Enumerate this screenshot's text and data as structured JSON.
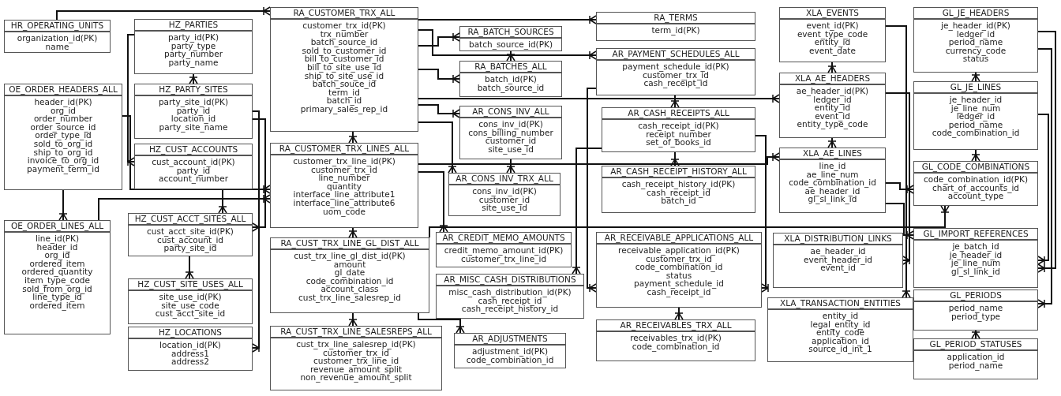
{
  "entities": [
    {
      "name": "HR_OPERATING_UNITS",
      "fields": [
        "organization_id(PK)",
        "name"
      ]
    },
    {
      "name": "HZ_PARTIES",
      "fields": [
        "party_id(PK)",
        "party_type",
        "party_number",
        "party_name"
      ]
    },
    {
      "name": "OE_ORDER_HEADERS_ALL",
      "fields": [
        "header_id(PK)",
        "org_id",
        "order_number",
        "order_source_id",
        "order_type_id",
        "sold_to_org_id",
        "ship_to_org_id",
        "invoice_to_org_id",
        "payment_term_id"
      ]
    },
    {
      "name": "HZ_PARTY_SITES",
      "fields": [
        "party_site_id(PK)",
        "party_id",
        "location_id",
        "party_site_name"
      ]
    },
    {
      "name": "HZ_CUST_ACCOUNTS",
      "fields": [
        "cust_account_id(PK)",
        "party_id",
        "account_number"
      ]
    },
    {
      "name": "OE_ORDER_LINES_ALL",
      "fields": [
        "line_id(PK)",
        "header_id",
        "org_id",
        "ordered_item",
        "ordered_quantity",
        "item_type_code",
        "sold_from_org_id",
        "line_type_id",
        "ordered_item"
      ]
    },
    {
      "name": "HZ_CUST_ACCT_SITES_ALL",
      "fields": [
        "cust_acct_site_id(PK)",
        "cust_account_id",
        "party_site_id"
      ]
    },
    {
      "name": "HZ_CUST_SITE_USES_ALL",
      "fields": [
        "site_use_id(PK)",
        "site_use_code",
        "cust_acct_site_id"
      ]
    },
    {
      "name": "HZ_LOCATIONS",
      "fields": [
        "location_id(PK)",
        "address1",
        "address2"
      ]
    },
    {
      "name": "RA_CUSTOMER_TRX_ALL",
      "fields": [
        "customer_trx_id(PK)",
        "trx_number",
        "batch_source_id",
        "sold_to_customer_id",
        "bill_to_customer_id",
        "bill_to_site_use_id",
        "ship_to_site_use_id",
        "batch_souce_id",
        "term_id",
        "batch_id",
        "primary_sales_rep_id"
      ]
    },
    {
      "name": "RA_CUSTOMER_TRX_LINES_ALL",
      "fields": [
        "customer_trx_line_id(PK)",
        "customer_trx_id",
        "line_number",
        "quantity",
        "interface_line_attribute1",
        "interface_line_attribute6",
        "uom_code"
      ]
    },
    {
      "name": "RA_CUST_TRX_LINE_GL_DIST_ALL",
      "fields": [
        "cust_trx_line_gl_dist_id(PK)",
        "amount",
        "gl_date",
        "code_combination_id",
        "account_class",
        "cust_trx_line_salesrep_id"
      ]
    },
    {
      "name": "RA_CUST_TRX_LINE_SALESREPS_ALL",
      "fields": [
        "cust_trx_line_salesrep_id(PK)",
        "customer_trx_id",
        "customer_trx_line_id",
        "revenue_amount_split",
        "non_revenue_amount_split"
      ]
    },
    {
      "name": "RA_BATCH_SOURCES",
      "fields": [
        "batch_source_id(PK)"
      ]
    },
    {
      "name": "RA_BATCHES_ALL",
      "fields": [
        "batch_id(PK)",
        "batch_source_id"
      ]
    },
    {
      "name": "AR_CONS_INV_ALL",
      "fields": [
        "cons_inv_id(PK)",
        "cons_billing_number",
        "customer_id",
        "site_use_id"
      ]
    },
    {
      "name": "AR_CONS_INV_TRX_ALL",
      "fields": [
        "cons_inv_id(PK)",
        "customer_id",
        "site_use_id"
      ]
    },
    {
      "name": "AR_CREDIT_MEMO_AMOUNTS",
      "fields": [
        "credit_memo_amount_id(PK)",
        "customer_trx_line_id"
      ]
    },
    {
      "name": "AR_MISC_CASH_DISTRIBUTIONS",
      "fields": [
        "misc_cash_distribution_id(PK)",
        "cash_receipt_id",
        "cash_receipt_history_id"
      ]
    },
    {
      "name": "AR_ADJUSTMENTS",
      "fields": [
        "adjustment_id(PK)",
        "code_combination_id"
      ]
    },
    {
      "name": "RA_TERMS",
      "fields": [
        "term_id(PK)"
      ]
    },
    {
      "name": "AR_PAYMENT_SCHEDULES_ALL",
      "fields": [
        "payment_schedule_id(PK)",
        "customer_trx_id",
        "cash_receipt_id"
      ]
    },
    {
      "name": "AR_CASH_RECEIPTS_ALL",
      "fields": [
        "cash_receipt_id(PK)",
        "receipt_number",
        "set_of_books_id"
      ]
    },
    {
      "name": "AR_CASH_RECEIPT_HISTORY_ALL",
      "fields": [
        "cash_receipt_history_id(PK)",
        "cash_receipt_id",
        "batch_id"
      ]
    },
    {
      "name": "AR_RECEIVABLE_APPLICATIONS_ALL",
      "fields": [
        "receivable_application_id(PK)",
        "customer_trx_id",
        "code_combination_id",
        "status",
        "payment_schedule_id",
        "cash_receipt_id"
      ]
    },
    {
      "name": "AR_RECEIVABLES_TRX_ALL",
      "fields": [
        "receivables_trx_id(PK)",
        "code_combination_id"
      ]
    },
    {
      "name": "XLA_EVENTS",
      "fields": [
        "event_id(PK)",
        "event_type_code",
        "entity_id",
        "event_date"
      ]
    },
    {
      "name": "XLA_AE_HEADERS",
      "fields": [
        "ae_header_id(PK)",
        "ledger_id",
        "entity_id",
        "event_id",
        "entity_type_code"
      ]
    },
    {
      "name": "XLA_AE_LINES",
      "fields": [
        "line_id",
        "ae_line_num",
        "code_combination_id",
        "ae_header_id",
        "gl_sl_link_id"
      ]
    },
    {
      "name": "XLA_DISTRIBUTION_LINKS",
      "fields": [
        "ae_header_id",
        "event_header_id",
        "event_id"
      ]
    },
    {
      "name": "XLA_TRANSACTION_ENTITIES",
      "fields": [
        "entity_id",
        "legal_entity_id",
        "entity_code",
        "application_id",
        "source_id_int_1"
      ]
    },
    {
      "name": "GL_JE_HEADERS",
      "fields": [
        "je_header_id(PK)",
        "ledger_id",
        "period_name",
        "currency_code",
        "status"
      ]
    },
    {
      "name": "GL_JE_LINES",
      "fields": [
        "je_header_id",
        "je_line_num",
        "ledger_id",
        "period_name",
        "code_combination_id"
      ]
    },
    {
      "name": "GL_CODE_COMBINATIONS",
      "fields": [
        "code_combination_id(PK)",
        "chart_of_accounts_id",
        "account_type"
      ]
    },
    {
      "name": "GL_IMPORT_REFERENCES",
      "fields": [
        "je_batch_id",
        "je_header_id",
        "je_line_num",
        "gl_sl_link_id"
      ]
    },
    {
      "name": "GL_PERIODS",
      "fields": [
        "period_name",
        "period_type"
      ]
    },
    {
      "name": "GL_PERIOD_STATUSES",
      "fields": [
        "application_id",
        "period_name"
      ]
    }
  ]
}
